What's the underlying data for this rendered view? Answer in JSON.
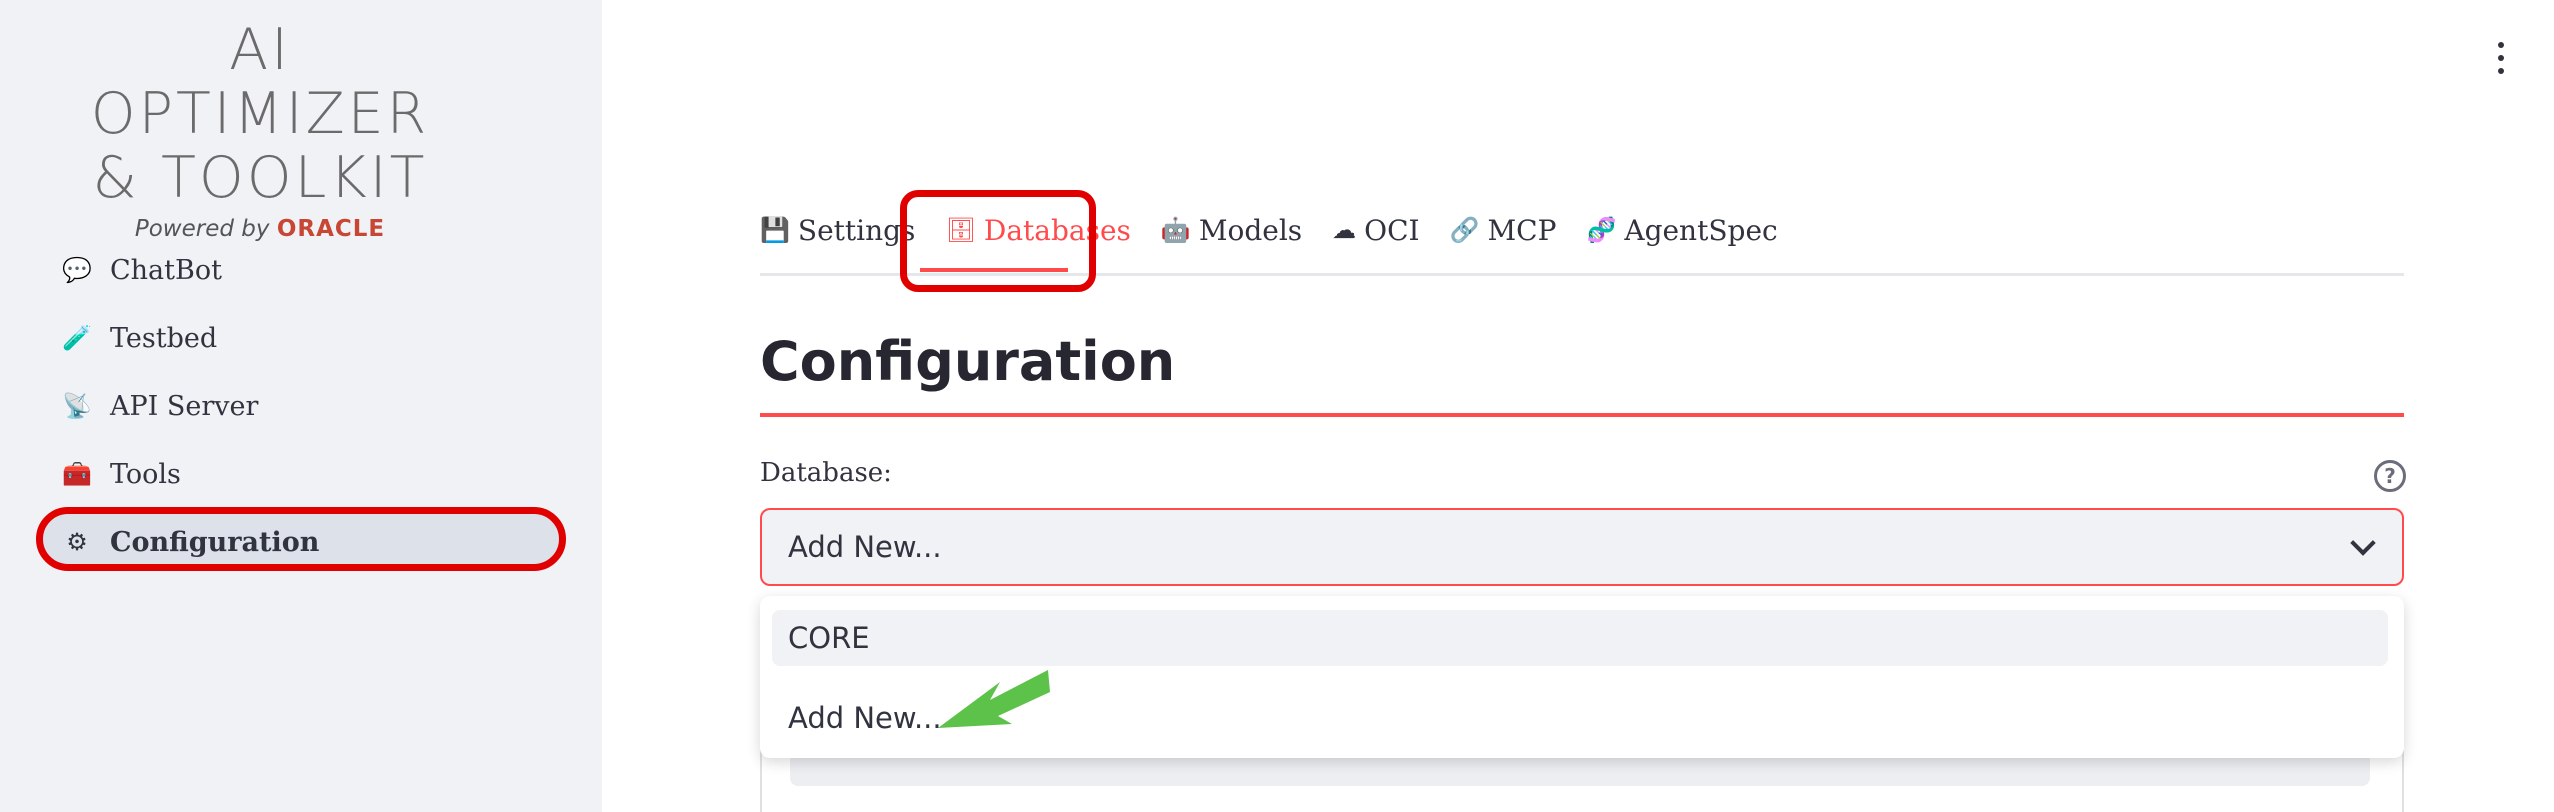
{
  "logo": {
    "line1": "AI OPTIMIZER",
    "line2": "& TOOLKIT",
    "powered_by": "Powered by",
    "brand": "ORACLE"
  },
  "sidebar": {
    "items": [
      {
        "label": "ChatBot",
        "icon": "💬"
      },
      {
        "label": "Testbed",
        "icon": "🧪"
      },
      {
        "label": "API Server",
        "icon": "📡"
      },
      {
        "label": "Tools",
        "icon": "🧰"
      },
      {
        "label": "Configuration",
        "icon": "⚙"
      }
    ],
    "active": "Configuration"
  },
  "tabs": [
    {
      "label": "Settings",
      "icon": "💾"
    },
    {
      "label": "Databases",
      "icon": "🗄"
    },
    {
      "label": "Models",
      "icon": "🤖"
    },
    {
      "label": "OCI",
      "icon": "☁"
    },
    {
      "label": "MCP",
      "icon": "🔗"
    },
    {
      "label": "AgentSpec",
      "icon": "🧬"
    }
  ],
  "active_tab": "Databases",
  "page": {
    "title": "Configuration",
    "field_label": "Database:",
    "help_icon": "?",
    "selected_value": "Add New...",
    "options": [
      "CORE",
      "Add New..."
    ],
    "hovered_option": "CORE"
  },
  "colors": {
    "accent": "#ff4b4b",
    "highlight": "#e00000",
    "arrow": "#5cc24a",
    "sidebar_bg": "#f0f2f6"
  }
}
